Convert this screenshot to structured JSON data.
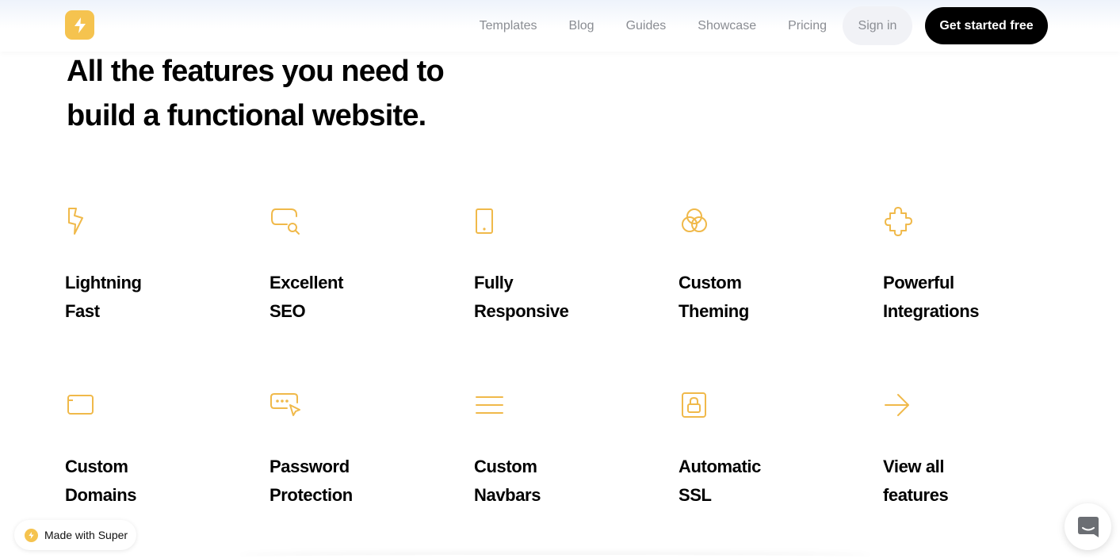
{
  "header": {
    "logo_icon": "lightning-icon",
    "nav": [
      {
        "label": "Templates"
      },
      {
        "label": "Blog"
      },
      {
        "label": "Guides"
      },
      {
        "label": "Showcase"
      },
      {
        "label": "Pricing"
      }
    ],
    "signin_label": "Sign in",
    "cta_label": "Get started free"
  },
  "hero": {
    "line1": "All the features you need to",
    "line2": "build a functional website."
  },
  "features": [
    {
      "icon": "lightning-icon",
      "line1": "Lightning",
      "line2": "Fast"
    },
    {
      "icon": "seo-search-icon",
      "line1": "Excellent",
      "line2": "SEO"
    },
    {
      "icon": "mobile-device-icon",
      "line1": "Fully",
      "line2": "Responsive"
    },
    {
      "icon": "color-circles-icon",
      "line1": "Custom",
      "line2": "Theming"
    },
    {
      "icon": "puzzle-piece-icon",
      "line1": "Powerful",
      "line2": "Integrations"
    },
    {
      "icon": "browser-window-icon",
      "line1": "Custom",
      "line2": "Domains"
    },
    {
      "icon": "password-cursor-icon",
      "line1": "Password",
      "line2": "Protection"
    },
    {
      "icon": "menu-lines-icon",
      "line1": "Custom",
      "line2": "Navbars"
    },
    {
      "icon": "lock-icon",
      "line1": "Automatic",
      "line2": "SSL"
    },
    {
      "icon": "arrow-right-icon",
      "line1": "View all",
      "line2": "features"
    }
  ],
  "badge": {
    "label": "Made with Super"
  },
  "chat": {
    "icon": "chat-icon"
  },
  "colors": {
    "accent": "#f5c34f",
    "icon_stroke": "#f0b94a",
    "nav_text": "#8a8d93",
    "cta_bg": "#000000"
  }
}
